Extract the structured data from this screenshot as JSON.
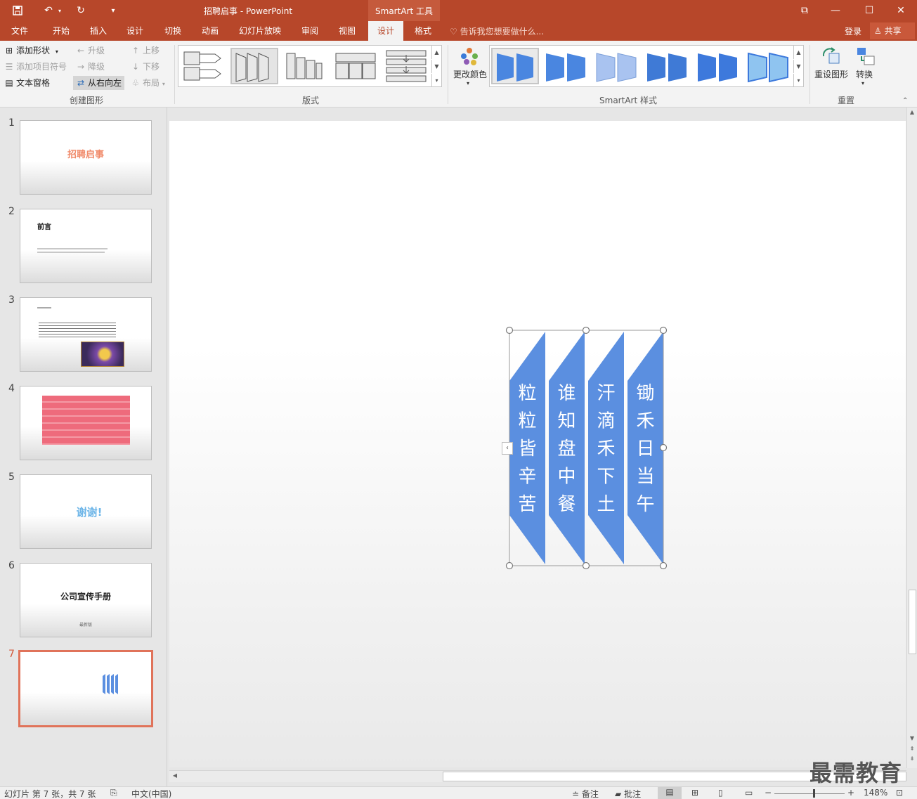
{
  "window": {
    "title": "招聘启事 - PowerPoint",
    "contextual_tab_group": "SmartArt 工具",
    "controls": {
      "restore": "⧉",
      "minimize": "—",
      "maximize": "☐",
      "close": "✕"
    }
  },
  "quick_access": {
    "icons": [
      "save-icon",
      "undo-icon",
      "redo-icon",
      "customize-icon"
    ]
  },
  "tabs": [
    {
      "label": "文件"
    },
    {
      "label": "开始"
    },
    {
      "label": "插入"
    },
    {
      "label": "设计"
    },
    {
      "label": "切换"
    },
    {
      "label": "动画"
    },
    {
      "label": "幻灯片放映"
    },
    {
      "label": "审阅"
    },
    {
      "label": "视图"
    },
    {
      "label": "设计",
      "active": true
    },
    {
      "label": "格式"
    }
  ],
  "tell_me": "告诉我您想要做什么...",
  "login": "登录",
  "share": "共享",
  "ribbon": {
    "create_graphic": {
      "label": "创建图形",
      "add_shape": "添加形状",
      "add_bullet": "添加项目符号",
      "text_pane": "文本窗格",
      "promote": "升级",
      "demote": "降级",
      "right_to_left": "从右向左",
      "move_up": "上移",
      "move_down": "下移",
      "layout": "布局"
    },
    "layouts": {
      "label": "版式"
    },
    "styles": {
      "label": "SmartArt 样式",
      "change_colors": "更改颜色"
    },
    "reset": {
      "label": "重置",
      "reset_graphic": "重设图形",
      "convert": "转换"
    }
  },
  "slides": [
    {
      "number": "1",
      "title": "招聘启事"
    },
    {
      "number": "2",
      "title": "前言"
    },
    {
      "number": "3",
      "title": ""
    },
    {
      "number": "4",
      "title": ""
    },
    {
      "number": "5",
      "title": "谢谢!"
    },
    {
      "number": "6",
      "title": "公司宣传手册",
      "subtitle": "最新版"
    },
    {
      "number": "7",
      "title": "",
      "active": true
    }
  ],
  "smartart": {
    "color": "#5b8fe0",
    "columns": [
      {
        "text": "粒粒皆辛苦",
        "chars": [
          "粒",
          "粒",
          "皆",
          "辛",
          "苦"
        ]
      },
      {
        "text": "谁知盘中餐",
        "chars": [
          "谁",
          "知",
          "盘",
          "中",
          "餐"
        ]
      },
      {
        "text": "汗滴禾下土",
        "chars": [
          "汗",
          "滴",
          "禾",
          "下",
          "土"
        ]
      },
      {
        "text": "锄禾日当午",
        "chars": [
          "锄",
          "禾",
          "日",
          "当",
          "午"
        ]
      }
    ]
  },
  "status": {
    "slide_info": "幻灯片 第 7 张，共 7 张",
    "language": "中文(中国)",
    "notes": "备注",
    "comments": "批注",
    "zoom": "148%"
  },
  "watermark": "最需教育",
  "colors": {
    "accent": "#b7472a",
    "smartart_blue": "#5b8fe0",
    "active_thumb_border": "#e0735a"
  }
}
